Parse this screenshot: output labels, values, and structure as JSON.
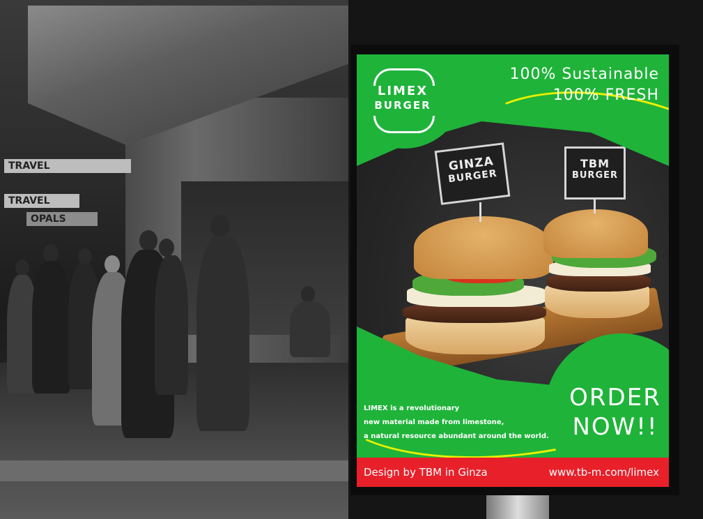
{
  "street": {
    "signs": [
      "TRAVEL",
      "TRAVEL",
      "OPALS"
    ]
  },
  "poster": {
    "logo": {
      "line1": "LIMEX",
      "line2": "BURGER"
    },
    "headline": {
      "line1": "100% Sustainable",
      "line2": "100% FRESH"
    },
    "burgers": [
      {
        "line1": "GINZA",
        "line2": "BURGER"
      },
      {
        "line1": "TBM",
        "line2": "BURGER"
      }
    ],
    "description": [
      "LIMEX is a revolutionary",
      "new material made from limestone,",
      "a natural resource abundant around the world."
    ],
    "cta": {
      "line1": "ORDER",
      "line2": "NOW!!"
    },
    "footer": {
      "credit": "Design by TBM in Ginza",
      "url": "www.tb-m.com/limex"
    },
    "colors": {
      "green": "#1fb33a",
      "red": "#e8202a",
      "accent_line": "#e7f000"
    }
  }
}
